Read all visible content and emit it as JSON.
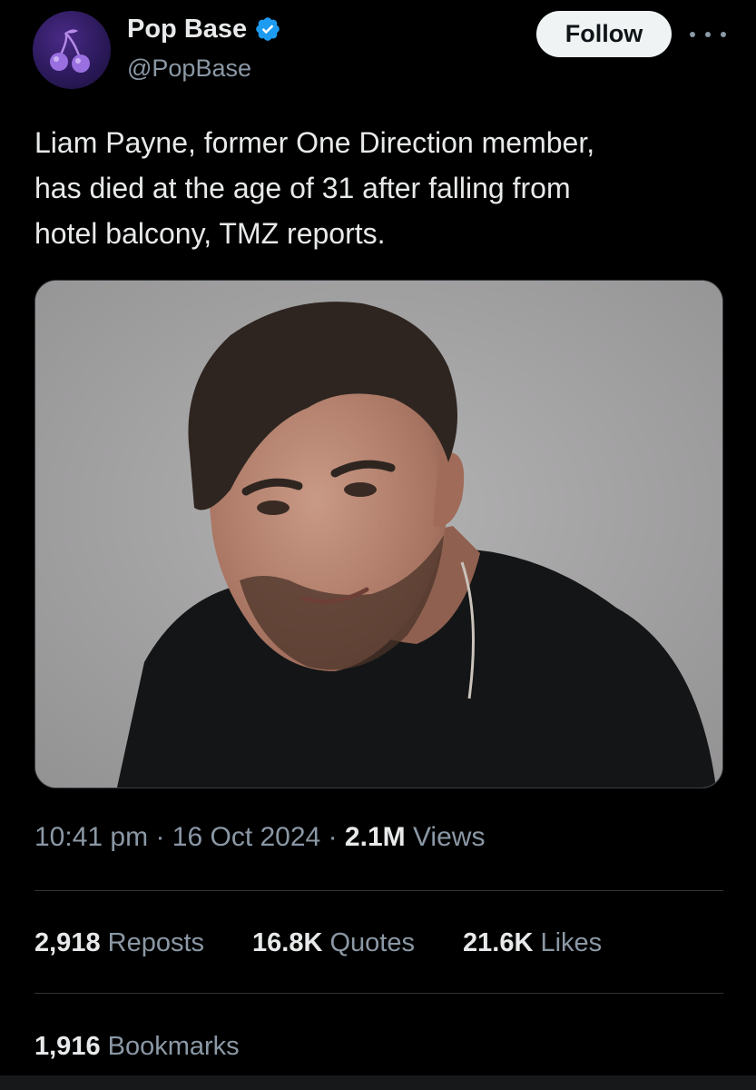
{
  "account": {
    "display_name": "Pop Base",
    "handle": "@PopBase",
    "verified": true,
    "follow_label": "Follow",
    "avatar_icon": "cherries-icon"
  },
  "tweet": {
    "text": "Liam Payne, former One Direction member,\nhas died at the age of 31 after falling from\nhotel balcony, TMZ reports.",
    "media_description": "portrait-photo",
    "time": "10:41 pm",
    "date": "16 Oct 2024",
    "separator": "·",
    "views_count": "2.1M",
    "views_label": "Views"
  },
  "stats": {
    "reposts": {
      "count": "2,918",
      "label": "Reposts"
    },
    "quotes": {
      "count": "16.8K",
      "label": "Quotes"
    },
    "likes": {
      "count": "21.6K",
      "label": "Likes"
    },
    "bookmarks": {
      "count": "1,916",
      "label": "Bookmarks"
    }
  },
  "colors": {
    "background": "#000000",
    "text_primary": "#e7e9ea",
    "text_secondary": "#8b98a5",
    "verified_blue": "#1d9bf0",
    "divider": "#2f3336",
    "follow_bg": "#eff3f4"
  }
}
